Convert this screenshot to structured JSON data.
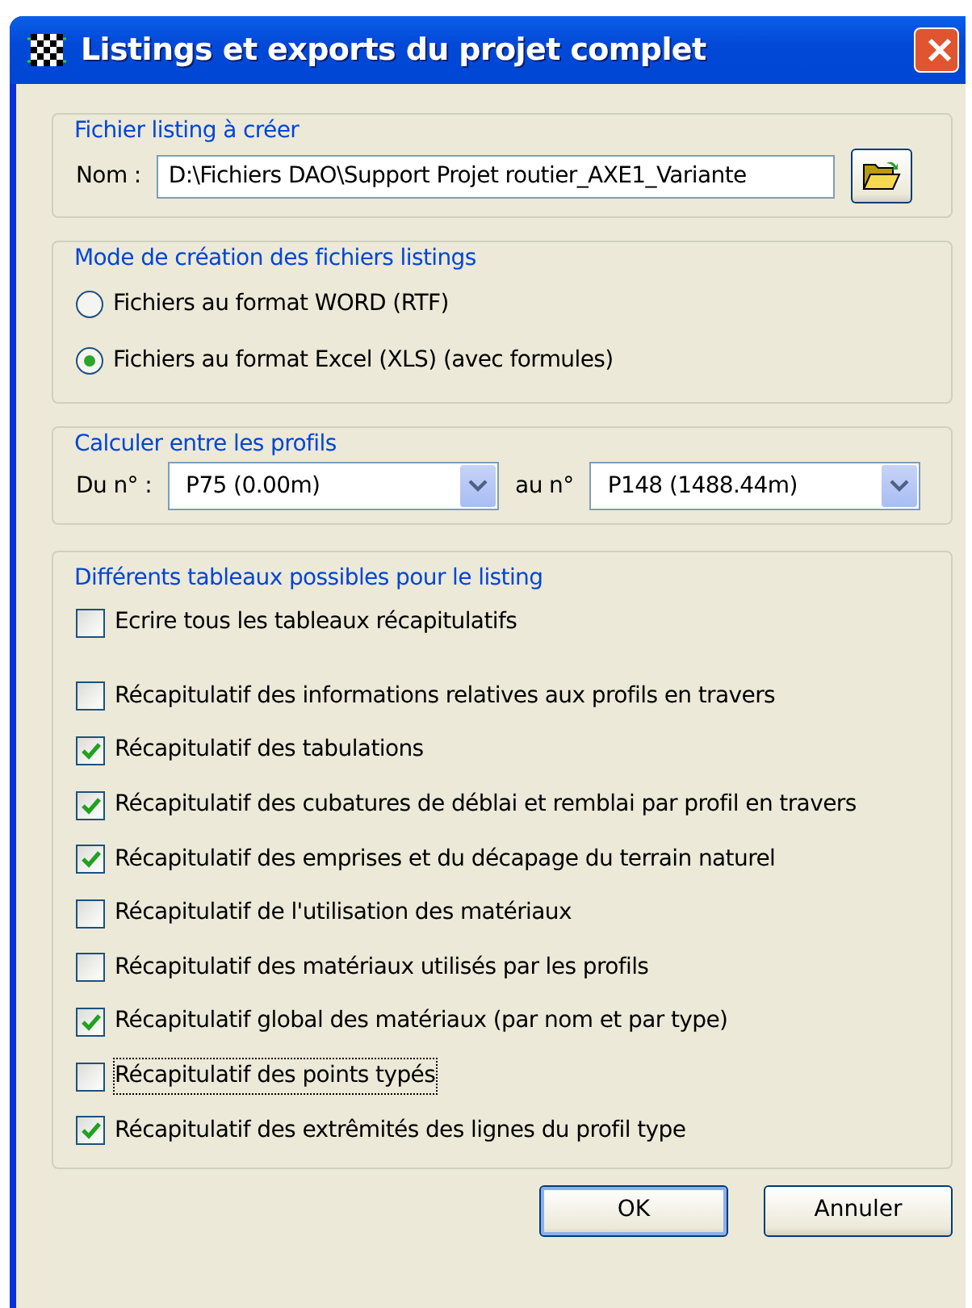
{
  "window": {
    "title": "Listings et exports du projet complet"
  },
  "file_group": {
    "legend": "Fichier listing à créer",
    "label": "Nom :",
    "value": "D:\\Fichiers DAO\\Support Projet routier_AXE1_Variante"
  },
  "mode_group": {
    "legend": "Mode de création des fichiers listings",
    "options": [
      {
        "label": "Fichiers au format WORD (RTF)",
        "selected": false
      },
      {
        "label": "Fichiers au format Excel (XLS) (avec formules)",
        "selected": true
      }
    ]
  },
  "range_group": {
    "legend": "Calculer entre les profils",
    "from_label": "Du n° :",
    "from_value": "P75 (0.00m)",
    "to_label": "au n°",
    "to_value": "P148 (1488.44m)"
  },
  "tables_group": {
    "legend": "Différents tableaux possibles pour le listing",
    "items": [
      {
        "label": "Ecrire tous les tableaux récapitulatifs",
        "checked": false,
        "focused": false
      },
      {
        "label": "Récapitulatif des informations relatives aux profils en travers",
        "checked": false,
        "focused": false
      },
      {
        "label": "Récapitulatif des tabulations",
        "checked": true,
        "focused": false
      },
      {
        "label": "Récapitulatif des cubatures de déblai et remblai par profil en travers",
        "checked": true,
        "focused": false
      },
      {
        "label": "Récapitulatif des emprises et du décapage du terrain naturel",
        "checked": true,
        "focused": false
      },
      {
        "label": "Récapitulatif de l'utilisation des matériaux",
        "checked": false,
        "focused": false
      },
      {
        "label": "Récapitulatif des matériaux utilisés par les profils",
        "checked": false,
        "focused": false
      },
      {
        "label": "Récapitulatif global des matériaux (par nom et par type)",
        "checked": true,
        "focused": false
      },
      {
        "label": "Récapitulatif des points typés",
        "checked": false,
        "focused": true
      },
      {
        "label": "Récapitulatif des extrêmités des lignes du profil type",
        "checked": true,
        "focused": false
      }
    ]
  },
  "buttons": [
    "OK",
    "Annuler"
  ]
}
